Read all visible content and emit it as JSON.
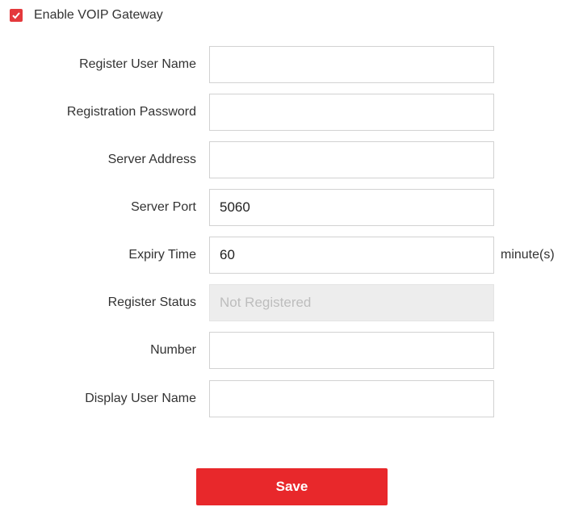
{
  "enable": {
    "label": "Enable VOIP Gateway",
    "checked": true,
    "icon": "checkmark-icon",
    "color": "#e4393c"
  },
  "fields": [
    {
      "label": "Register User Name",
      "value": "",
      "placeholder": ""
    },
    {
      "label": "Registration Password",
      "value": "",
      "placeholder": ""
    },
    {
      "label": "Server Address",
      "value": "",
      "placeholder": ""
    },
    {
      "label": "Server Port",
      "value": "5060",
      "placeholder": ""
    },
    {
      "label": "Expiry Time",
      "value": "60",
      "placeholder": "",
      "unit": "minute(s)"
    },
    {
      "label": "Register Status",
      "value": "Not Registered",
      "placeholder": "",
      "disabled": true
    },
    {
      "label": "Number",
      "value": "",
      "placeholder": ""
    },
    {
      "label": "Display User Name",
      "value": "",
      "placeholder": ""
    }
  ],
  "save": {
    "label": "Save",
    "color": "#e8282b"
  }
}
